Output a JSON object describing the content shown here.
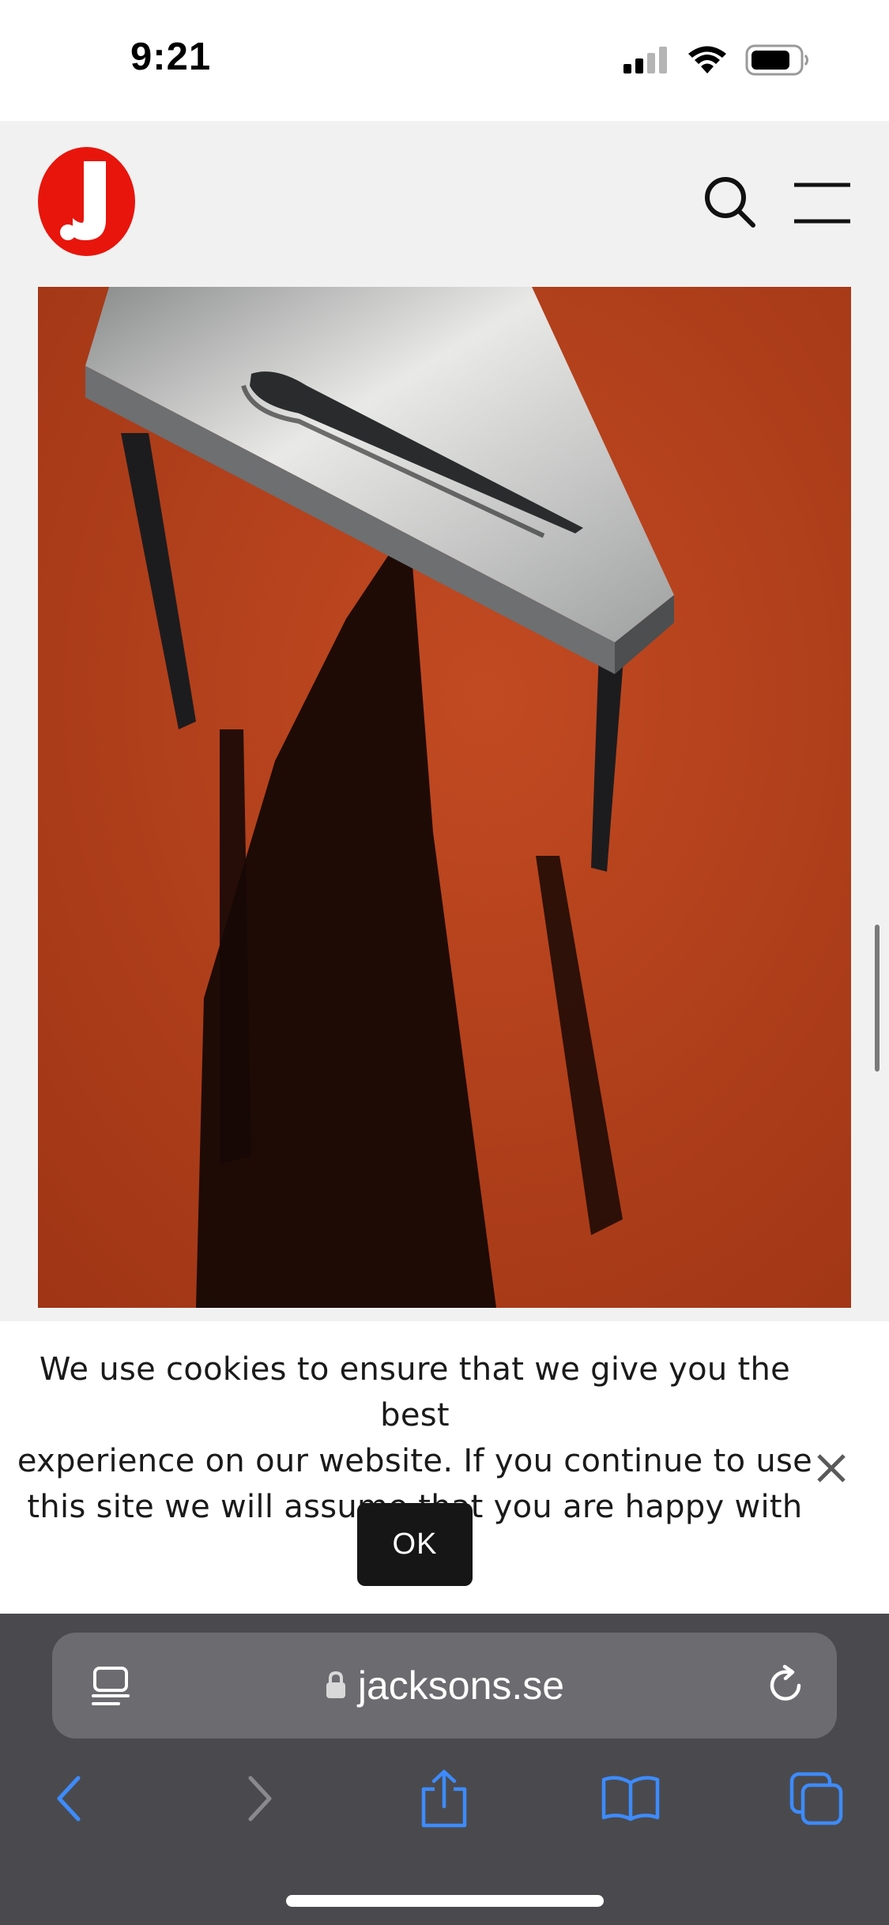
{
  "status_bar": {
    "time": "9:21",
    "icons": [
      "cellular-signal-icon",
      "wifi-icon",
      "battery-icon"
    ]
  },
  "header": {
    "logo_letter": "J",
    "logo_color": "#e8150c",
    "icons": [
      "search-icon",
      "hamburger-menu-icon"
    ]
  },
  "hero": {
    "image_subject_colors": {
      "carpet": "#b3401c",
      "shadow": "#1a0a06",
      "table": "#9a9c9c"
    }
  },
  "cookie_banner": {
    "lines": [
      "We use cookies to ensure that we give you the best",
      "experience on our website. If you continue to use",
      "this site we will assume that you are happy with it."
    ],
    "ok_label": "OK",
    "close_icon": "close-icon"
  },
  "browser": {
    "url": "jacksons.se",
    "toolbar_icons": [
      "back-icon",
      "forward-icon",
      "share-icon",
      "bookmarks-icon",
      "tabs-icon"
    ],
    "accent": "#3d8bfd"
  }
}
